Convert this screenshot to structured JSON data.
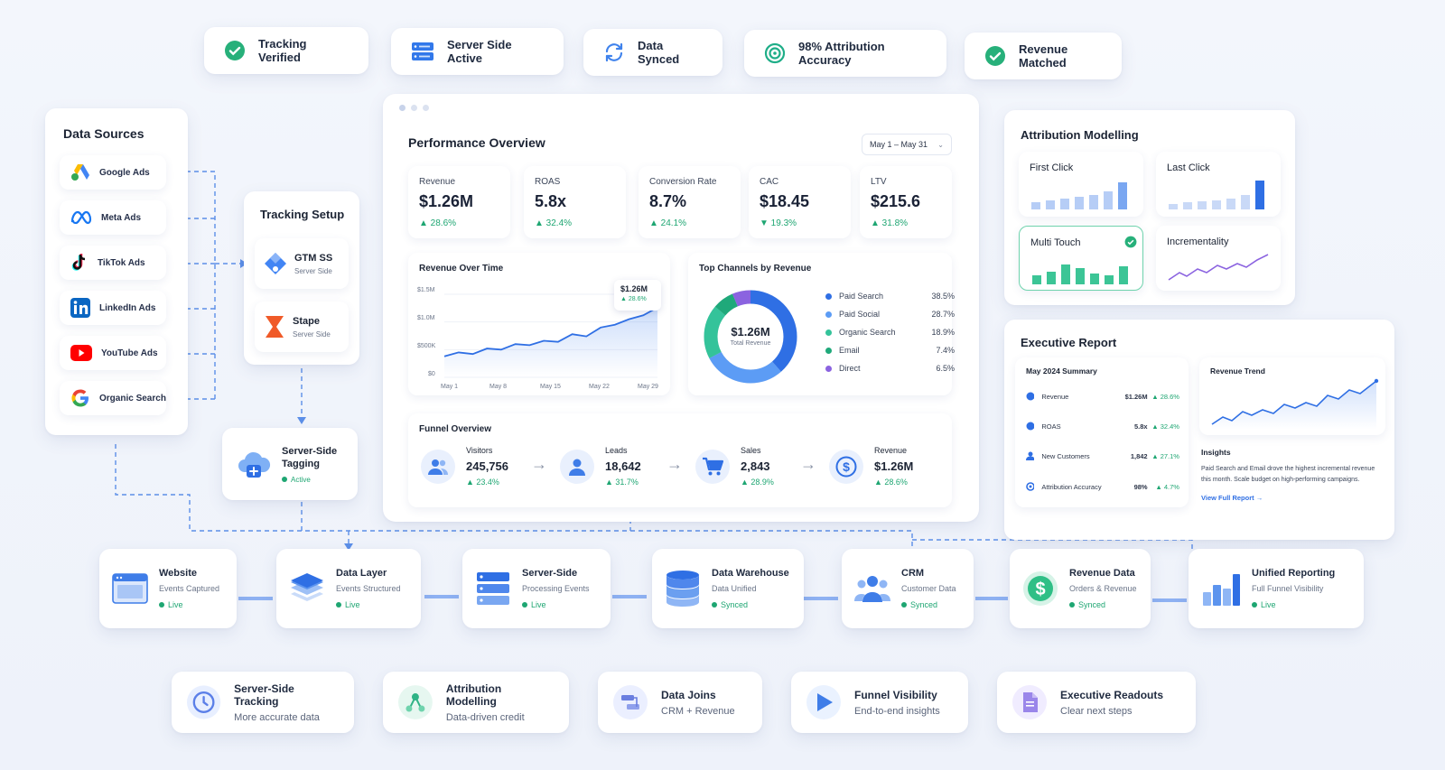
{
  "status_pills": [
    {
      "label": "Tracking Verified",
      "icon": "check-circle-icon"
    },
    {
      "label": "Server Side Active",
      "icon": "server-icon"
    },
    {
      "label": "Data Synced",
      "icon": "sync-icon"
    },
    {
      "label": "98% Attribution Accuracy",
      "icon": "target-icon"
    },
    {
      "label": "Revenue Matched",
      "icon": "check-circle-icon"
    }
  ],
  "data_sources": {
    "title": "Data Sources",
    "items": [
      {
        "label": "Google Ads",
        "icon": "google-ads-icon"
      },
      {
        "label": "Meta Ads",
        "icon": "meta-icon"
      },
      {
        "label": "TikTok Ads",
        "icon": "tiktok-icon"
      },
      {
        "label": "LinkedIn Ads",
        "icon": "linkedin-icon"
      },
      {
        "label": "YouTube Ads",
        "icon": "youtube-icon"
      },
      {
        "label": "Organic Search",
        "icon": "google-icon"
      }
    ]
  },
  "tracking_setup": {
    "title": "Tracking Setup",
    "items": [
      {
        "label": "GTM SS",
        "sub": "Server Side"
      },
      {
        "label": "Stape",
        "sub": "Server Side"
      }
    ]
  },
  "server_side_tagging": {
    "title": "Server-Side Tagging",
    "status": "Active"
  },
  "performance": {
    "title": "Performance Overview",
    "date_range": "May 1 – May 31",
    "kpis": [
      {
        "label": "Revenue",
        "value": "$1.26M",
        "change": "▲ 28.6%"
      },
      {
        "label": "ROAS",
        "value": "5.8x",
        "change": "▲ 32.4%"
      },
      {
        "label": "Conversion Rate",
        "value": "8.7%",
        "change": "▲ 24.1%"
      },
      {
        "label": "CAC",
        "value": "$18.45",
        "change": "▼ 19.3%"
      },
      {
        "label": "LTV",
        "value": "$215.6",
        "change": "▲ 31.8%"
      }
    ],
    "revenue_chart": {
      "title": "Revenue Over Time",
      "tooltip_value": "$1.26M",
      "tooltip_change": "▲ 28.6%",
      "y_ticks": [
        "$1.5M",
        "$1.0M",
        "$500K",
        "$0"
      ],
      "x_ticks": [
        "May 1",
        "May 8",
        "May 15",
        "May 22",
        "May 29"
      ]
    },
    "channels": {
      "title": "Top Channels by Revenue",
      "center_value": "$1.26M",
      "center_label": "Total Revenue"
    },
    "funnel": {
      "title": "Funnel Overview",
      "steps": [
        {
          "label": "Visitors",
          "value": "245,756",
          "change": "▲ 23.4%",
          "icon": "users-icon"
        },
        {
          "label": "Leads",
          "value": "18,642",
          "change": "▲ 31.7%",
          "icon": "user-icon"
        },
        {
          "label": "Sales",
          "value": "2,843",
          "change": "▲ 28.9%",
          "icon": "cart-icon"
        },
        {
          "label": "Revenue",
          "value": "$1.26M",
          "change": "▲ 28.6%",
          "icon": "dollar-icon"
        }
      ]
    }
  },
  "chart_data": [
    {
      "type": "line",
      "title": "Revenue Over Time",
      "x": [
        "May 1",
        "May 3",
        "May 5",
        "May 7",
        "May 9",
        "May 11",
        "May 13",
        "May 15",
        "May 17",
        "May 19",
        "May 21",
        "May 23",
        "May 25",
        "May 27",
        "May 29",
        "May 31"
      ],
      "values": [
        0.38,
        0.45,
        0.42,
        0.52,
        0.5,
        0.6,
        0.58,
        0.66,
        0.64,
        0.78,
        0.74,
        0.9,
        0.95,
        1.05,
        1.12,
        1.26
      ],
      "ylim": [
        0,
        1.5
      ],
      "y_unit": "$M"
    },
    {
      "type": "pie",
      "title": "Top Channels by Revenue",
      "categories": [
        "Paid Search",
        "Paid Social",
        "Organic Search",
        "Email",
        "Direct"
      ],
      "values": [
        38.5,
        28.7,
        18.9,
        7.4,
        6.5
      ],
      "labels": [
        "38.5%",
        "28.7%",
        "18.9%",
        "7.4%",
        "6.5%"
      ],
      "colors": [
        "#2f6fe4",
        "#5c9cf5",
        "#34c39a",
        "#1fa97a",
        "#8b63e0"
      ]
    }
  ],
  "attribution": {
    "title": "Attribution Modelling",
    "models": [
      {
        "label": "First Click"
      },
      {
        "label": "Last Click"
      },
      {
        "label": "Multi Touch"
      },
      {
        "label": "Incrementality"
      }
    ]
  },
  "executive": {
    "title": "Executive Report",
    "summary_title": "May 2024 Summary",
    "rows": [
      {
        "label": "Revenue",
        "value": "$1.26M",
        "change": "▲ 28.6%"
      },
      {
        "label": "ROAS",
        "value": "5.8x",
        "change": "▲ 32.4%"
      },
      {
        "label": "New Customers",
        "value": "1,842",
        "change": "▲ 27.1%"
      },
      {
        "label": "Attribution Accuracy",
        "value": "98%",
        "change": "▲ 4.7%"
      }
    ],
    "trend_title": "Revenue Trend",
    "insights_title": "Insights",
    "insights_text": "Paid Search and Email drove the highest incremental revenue this month. Scale budget on high-performing campaigns.",
    "link": "View Full Report →"
  },
  "pipeline": [
    {
      "title": "Website",
      "sub": "Events Captured",
      "status": "Live"
    },
    {
      "title": "Data Layer",
      "sub": "Events Structured",
      "status": "Live"
    },
    {
      "title": "Server-Side",
      "sub": "Processing Events",
      "status": "Live"
    },
    {
      "title": "Data Warehouse",
      "sub": "Data Unified",
      "status": "Synced"
    },
    {
      "title": "CRM",
      "sub": "Customer Data",
      "status": "Synced"
    },
    {
      "title": "Revenue Data",
      "sub": "Orders & Revenue",
      "status": "Synced"
    },
    {
      "title": "Unified Reporting",
      "sub": "Full Funnel Visibility",
      "status": "Live"
    }
  ],
  "features": [
    {
      "title": "Server-Side Tracking",
      "sub": "More accurate data"
    },
    {
      "title": "Attribution Modelling",
      "sub": "Data-driven credit"
    },
    {
      "title": "Data Joins",
      "sub": "CRM + Revenue"
    },
    {
      "title": "Funnel Visibility",
      "sub": "End-to-end insights"
    },
    {
      "title": "Executive Readouts",
      "sub": "Clear next steps"
    }
  ],
  "colors": {
    "accent": "#2f6fe4",
    "green": "#1ea672",
    "text": "#1c2434"
  }
}
